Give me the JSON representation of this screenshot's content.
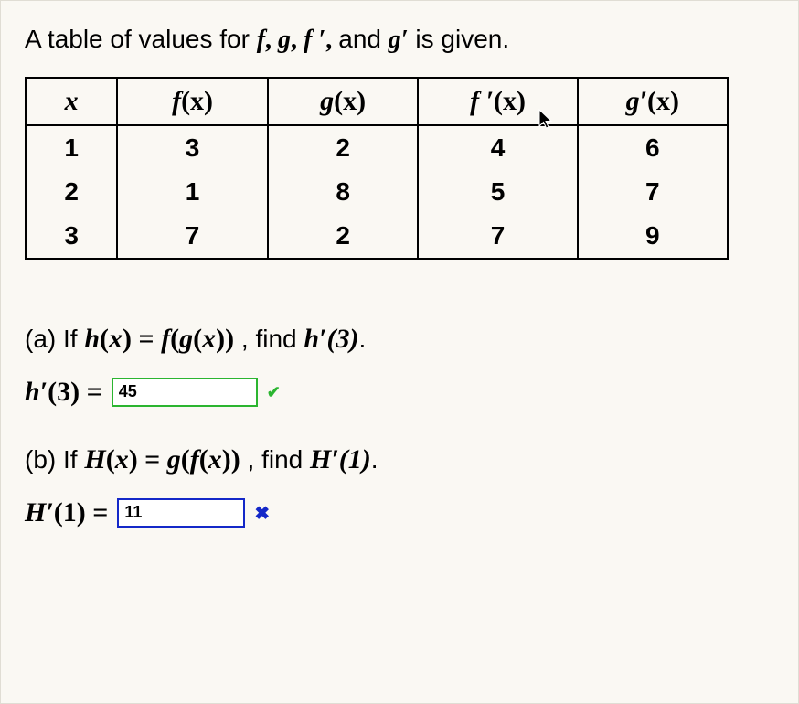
{
  "intro_pre": "A table of values for ",
  "intro_mid": "and ",
  "intro_post": " is given.",
  "fn_f": "f",
  "fn_g": "g",
  "fn_fp": "f ′",
  "fn_gp": "g′",
  "comma": ", ",
  "hdr": {
    "x": "x",
    "f": "f",
    "g": "g",
    "fp": "f ′",
    "gp": "g′",
    "arg": "(x)"
  },
  "chart_data": {
    "type": "table",
    "columns": [
      "x",
      "f(x)",
      "g(x)",
      "f'(x)",
      "g'(x)"
    ],
    "rows": [
      {
        "x": "1",
        "f": "3",
        "g": "2",
        "fp": "4",
        "gp": "6"
      },
      {
        "x": "2",
        "f": "1",
        "g": "8",
        "fp": "5",
        "gp": "7"
      },
      {
        "x": "3",
        "f": "7",
        "g": "2",
        "fp": "7",
        "gp": "9"
      }
    ]
  },
  "qa": {
    "label": "(a) If ",
    "def": "h(x) = f(g(x))",
    "find_pre": ", find ",
    "target": "h′(3)",
    "period": ".",
    "ans_label": "h′(3) = ",
    "ans_value": "45",
    "status": "correct"
  },
  "qb": {
    "label": "(b) If ",
    "def": "H(x) = g(f(x))",
    "find_pre": ", find ",
    "target": "H′(1)",
    "period": ".",
    "ans_label": "H′(1) = ",
    "ans_value": "11",
    "status": "incorrect"
  },
  "icons": {
    "check": "✔",
    "cross": "✖"
  }
}
